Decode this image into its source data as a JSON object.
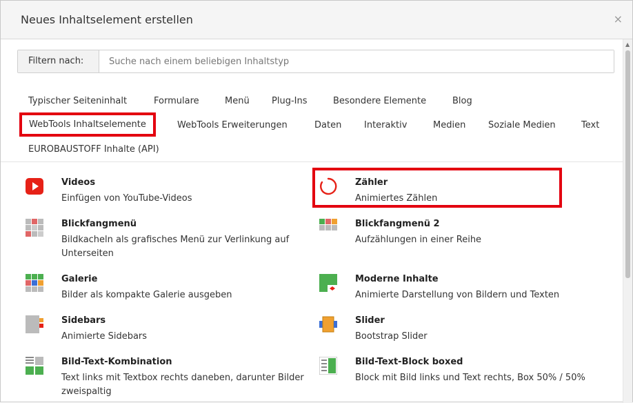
{
  "header": {
    "title": "Neues Inhaltselement erstellen",
    "close_label": "×"
  },
  "filter": {
    "label": "Filtern nach:",
    "placeholder": "Suche nach einem beliebigen Inhaltstyp"
  },
  "tabs": [
    {
      "label": "Typischer Seiteninhalt"
    },
    {
      "label": "Formulare"
    },
    {
      "label": "Menü"
    },
    {
      "label": "Plug-Ins"
    },
    {
      "label": "Besondere Elemente"
    },
    {
      "label": "Blog"
    },
    {
      "label": "WebTools Inhaltselemente",
      "active": true
    },
    {
      "label": "WebTools Erweiterungen"
    },
    {
      "label": "Daten"
    },
    {
      "label": "Interaktiv"
    },
    {
      "label": "Medien"
    },
    {
      "label": "Soziale Medien"
    },
    {
      "label": "Text"
    },
    {
      "label": "EUROBAUSTOFF Inhalte (API)"
    }
  ],
  "items": [
    {
      "title": "Videos",
      "desc": "Einfügen von YouTube-Videos",
      "icon": "youtube-icon"
    },
    {
      "title": "Zähler",
      "desc": "Animiertes Zählen",
      "icon": "counter-icon",
      "highlighted": true
    },
    {
      "title": "Blickfangmenü",
      "desc": "Bildkacheln als grafisches Menü zur Verlinkung auf Unterseiten",
      "icon": "tile-menu-icon"
    },
    {
      "title": "Blickfangmenü 2",
      "desc": "Aufzählungen in einer Reihe",
      "icon": "tile-menu-2-icon"
    },
    {
      "title": "Galerie",
      "desc": "Bilder als kompakte Galerie ausgeben",
      "icon": "gallery-icon"
    },
    {
      "title": "Moderne Inhalte",
      "desc": "Animierte Darstellung von Bildern und Texten",
      "icon": "modern-content-icon"
    },
    {
      "title": "Sidebars",
      "desc": "Animierte Sidebars",
      "icon": "sidebar-icon"
    },
    {
      "title": "Slider",
      "desc": "Bootstrap Slider",
      "icon": "slider-icon"
    },
    {
      "title": "Bild-Text-Kombination",
      "desc": "Text links mit Textbox rechts daneben, darunter Bilder zweispaltig",
      "icon": "image-text-icon"
    },
    {
      "title": "Bild-Text-Block boxed",
      "desc": "Block mit Bild links und Text rechts, Box 50% / 50%",
      "icon": "image-text-boxed-icon"
    }
  ],
  "colors": {
    "highlight": "#e3000f",
    "youtube": "#e62117",
    "green": "#4caf50",
    "orange": "#f0a030"
  }
}
